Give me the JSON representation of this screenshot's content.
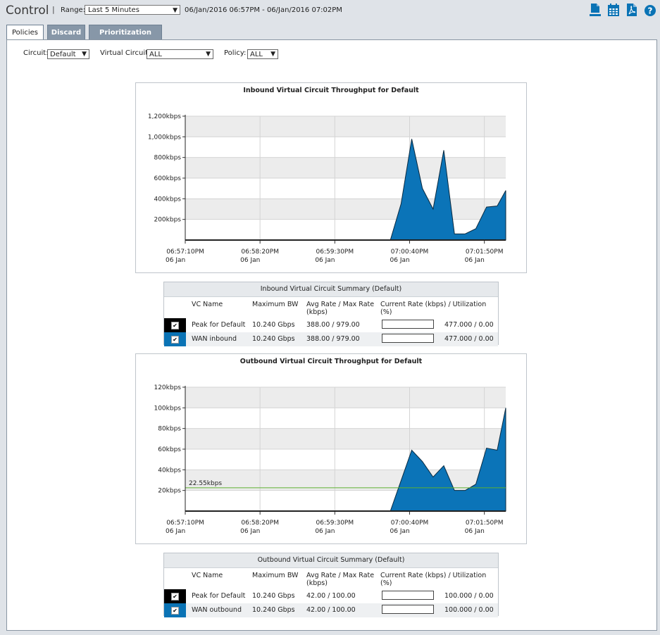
{
  "header": {
    "title": "Control",
    "separator": "|",
    "range_label": "Range:",
    "range_value": "Last 5 Minutes",
    "range_text": "06/Jan/2016 06:57PM - 06/Jan/2016 07:02PM",
    "icons": [
      "report-icon",
      "calendar-icon",
      "pdf-icon",
      "help-icon"
    ],
    "help_glyph": "?"
  },
  "tabs": [
    {
      "label": "Policies",
      "active": true
    },
    {
      "label": "Discard",
      "active": false
    },
    {
      "label": "Prioritization Ratio",
      "active": false
    }
  ],
  "filters": {
    "circuit_label": "Circuit:",
    "circuit_value": "Default",
    "vc_label": "Virtual Circuit:",
    "vc_value": "ALL",
    "policy_label": "Policy:",
    "policy_value": "ALL",
    "dropdown_glyph": "▼"
  },
  "colors": {
    "accent": "#0a73b5",
    "fill": "#0b74b8",
    "threshold": "#5cb030",
    "tab_inactive": "#8797a8"
  },
  "chart_data": [
    {
      "type": "area",
      "title": "Inbound Virtual Circuit Throughput for Default",
      "y_unit": "kbps",
      "ylim": [
        0,
        1200
      ],
      "yticks": [
        "200kbps",
        "400kbps",
        "600kbps",
        "800kbps",
        "1,000kbps",
        "1,200kbps"
      ],
      "ytick_values": [
        200,
        400,
        600,
        800,
        1000,
        1200
      ],
      "xticks": [
        {
          "time": "06:57:10PM",
          "date": "06 Jan",
          "t": 0
        },
        {
          "time": "06:58:20PM",
          "date": "06 Jan",
          "t": 70
        },
        {
          "time": "06:59:30PM",
          "date": "06 Jan",
          "t": 140
        },
        {
          "time": "07:00:40PM",
          "date": "06 Jan",
          "t": 210
        },
        {
          "time": "07:01:50PM",
          "date": "06 Jan",
          "t": 280
        }
      ],
      "x_range_seconds": [
        0,
        300
      ],
      "x_seconds": [
        0,
        192,
        202,
        212,
        222,
        232,
        242,
        252,
        262,
        272,
        282,
        292,
        300
      ],
      "values": [
        0,
        0,
        350,
        979,
        500,
        300,
        870,
        60,
        60,
        110,
        320,
        330,
        480
      ],
      "grid": true,
      "threshold": null
    },
    {
      "type": "area",
      "title": "Outbound Virtual Circuit Throughput for Default",
      "y_unit": "kbps",
      "ylim": [
        0,
        120
      ],
      "yticks": [
        "20kbps",
        "40kbps",
        "60kbps",
        "80kbps",
        "100kbps",
        "120kbps"
      ],
      "ytick_values": [
        20,
        40,
        60,
        80,
        100,
        120
      ],
      "xticks": [
        {
          "time": "06:57:10PM",
          "date": "06 Jan",
          "t": 0
        },
        {
          "time": "06:58:20PM",
          "date": "06 Jan",
          "t": 70
        },
        {
          "time": "06:59:30PM",
          "date": "06 Jan",
          "t": 140
        },
        {
          "time": "07:00:40PM",
          "date": "06 Jan",
          "t": 210
        },
        {
          "time": "07:01:50PM",
          "date": "06 Jan",
          "t": 280
        }
      ],
      "x_range_seconds": [
        0,
        300
      ],
      "x_seconds": [
        0,
        192,
        212,
        222,
        232,
        242,
        252,
        262,
        272,
        282,
        292,
        300
      ],
      "values": [
        0,
        0,
        59,
        48,
        33,
        44,
        20,
        20,
        26,
        61,
        59,
        100
      ],
      "grid": true,
      "threshold": {
        "value": 22.55,
        "label": "22.55kbps"
      }
    }
  ],
  "inbound_summary": {
    "title": "Inbound Virtual Circuit Summary (Default)",
    "headers": [
      "VC Name",
      "Maximum BW",
      "Avg Rate / Max Rate (kbps)",
      "Current Rate (kbps) / Utilization (%)"
    ],
    "rows": [
      {
        "swatch": "#000000",
        "name": "Peak for Default",
        "max_bw": "10.240 Gbps",
        "avg_max": "388.00 / 979.00",
        "current": "477.000 / 0.00",
        "bar_fill": 0.0
      },
      {
        "swatch": "#0a73b5",
        "name": "WAN inbound",
        "max_bw": "10.240 Gbps",
        "avg_max": "388.00 / 979.00",
        "current": "477.000 / 0.00",
        "bar_fill": 0.0
      }
    ]
  },
  "outbound_summary": {
    "title": "Outbound Virtual Circuit Summary (Default)",
    "headers": [
      "VC Name",
      "Maximum BW",
      "Avg Rate / Max Rate (kbps)",
      "Current Rate (kbps) / Utilization (%)"
    ],
    "rows": [
      {
        "swatch": "#000000",
        "name": "Peak for Default",
        "max_bw": "10.240 Gbps",
        "avg_max": "42.00 / 100.00",
        "current": "100.000 / 0.00",
        "bar_fill": 0.0
      },
      {
        "swatch": "#0a73b5",
        "name": "WAN outbound",
        "max_bw": "10.240 Gbps",
        "avg_max": "42.00 / 100.00",
        "current": "100.000 / 0.00",
        "bar_fill": 0.0
      }
    ]
  },
  "checkbox_glyph": "✔"
}
